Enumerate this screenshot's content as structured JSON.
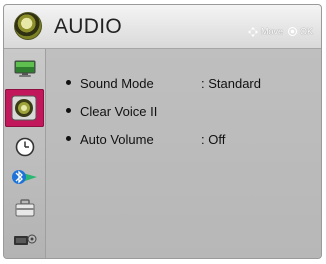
{
  "header": {
    "title": "AUDIO",
    "hint_move": "Move",
    "hint_ok": "OK"
  },
  "sidebar": {
    "items": [
      {
        "icon": "picture-icon",
        "active": false
      },
      {
        "icon": "audio-speaker-icon",
        "active": true
      },
      {
        "icon": "clock-icon",
        "active": false
      },
      {
        "icon": "network-icon",
        "active": false
      },
      {
        "icon": "option-toolbox-icon",
        "active": false
      },
      {
        "icon": "input-device-icon",
        "active": false
      }
    ]
  },
  "menu": {
    "items": [
      {
        "label": "Sound Mode",
        "value": ": Standard"
      },
      {
        "label": "Clear Voice II",
        "value": ""
      },
      {
        "label": "Auto Volume",
        "value": ": Off"
      }
    ]
  },
  "colors": {
    "active_tab": "#c2185b",
    "panel_bg": "#b9b9b9"
  }
}
